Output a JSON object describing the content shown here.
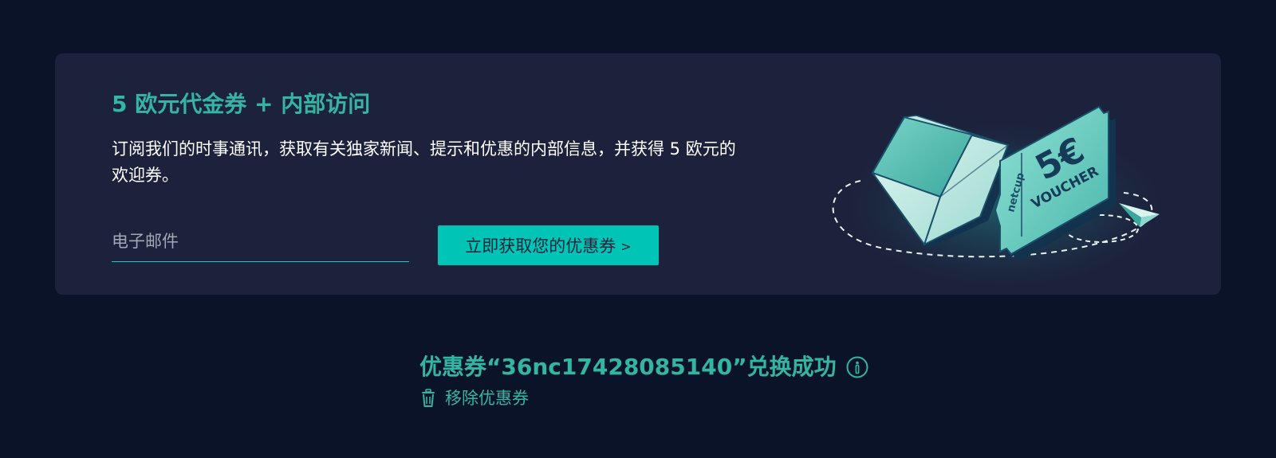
{
  "promo": {
    "title": "5 欧元代金券 + 内部访问",
    "description": "订阅我们的时事通讯，获取有关独家新闻、提示和优惠的内部信息，并获得 5 欧元的欢迎券。",
    "email_placeholder": "电子邮件",
    "email_value": "",
    "cta_label": "立即获取您的优惠券",
    "cta_arrow": ">",
    "illustration": {
      "voucher_amount": "5€",
      "voucher_word": "VOUCHER",
      "brand": "netcup",
      "icons": [
        "envelope-icon",
        "voucher-ticket-icon",
        "paper-plane-icon"
      ]
    }
  },
  "coupon_status": {
    "message": "优惠券“36nc17428085140”兑换成功",
    "remove_label": "移除优惠券",
    "icons": [
      "info-icon",
      "trash-icon"
    ]
  },
  "colors": {
    "page_background": "#0b1328",
    "card_background": "#1d223c",
    "accent_teal": "#34b5a3",
    "button_teal": "#00c4b5",
    "text_white": "#ffffff",
    "placeholder_gray": "#a2a7b6"
  }
}
